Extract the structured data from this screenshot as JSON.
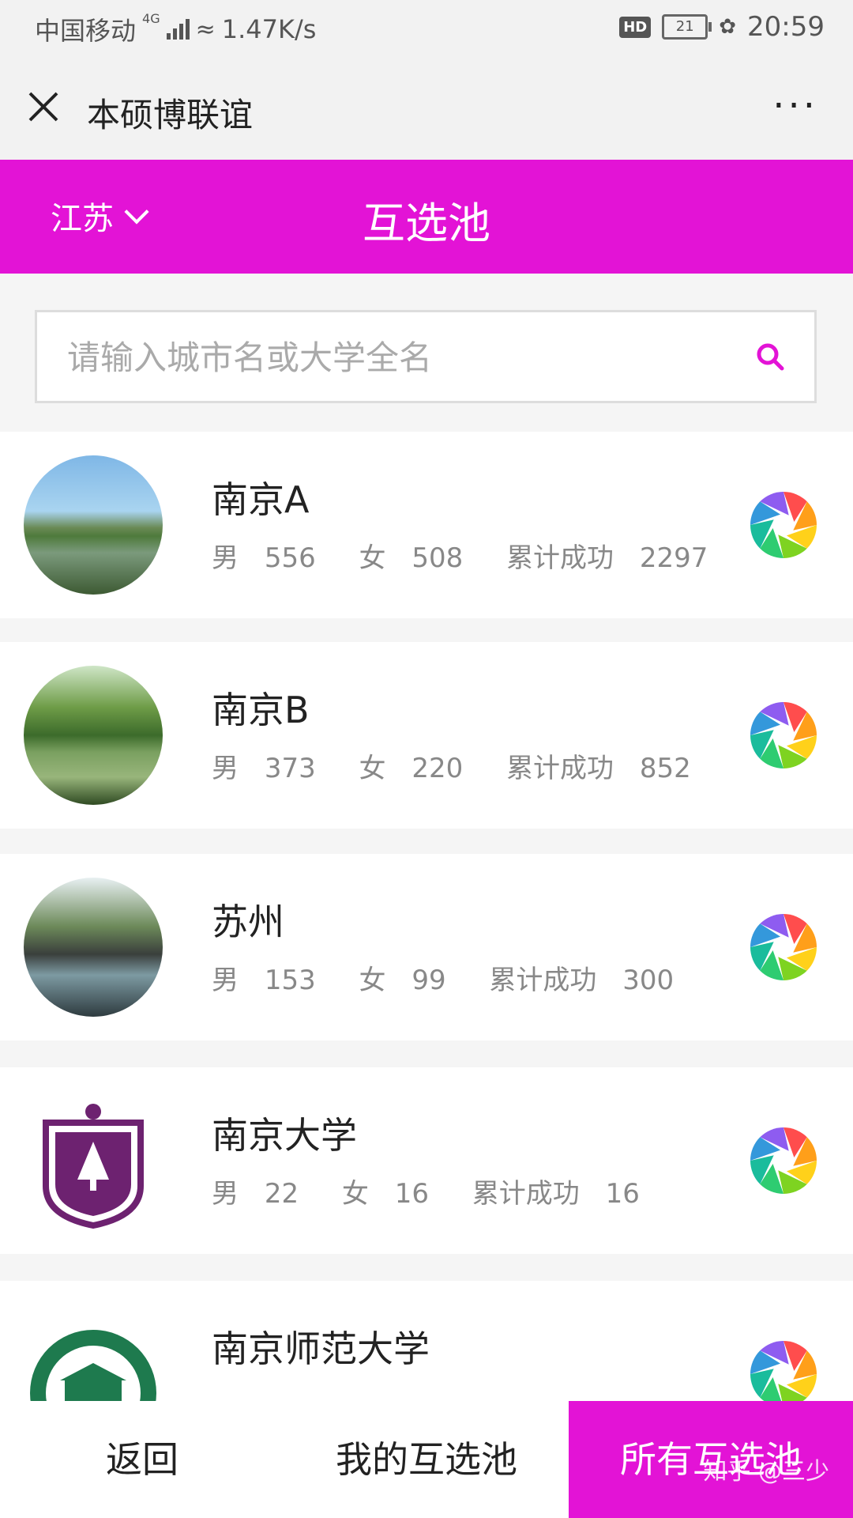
{
  "status_bar": {
    "carrier": "中国移动",
    "network": "4G",
    "speed": "1.47K/s",
    "hd": "HD",
    "battery": "21",
    "time": "20:59"
  },
  "title_bar": {
    "title": "本硕博联谊",
    "more": "···"
  },
  "header": {
    "province": "江苏",
    "title": "互选池",
    "accent_color": "#e313d6"
  },
  "search": {
    "placeholder": "请输入城市名或大学全名"
  },
  "pools": [
    {
      "name": "南京A",
      "male_label": "男",
      "male": "556",
      "female_label": "女",
      "female": "508",
      "success_label": "累计成功",
      "success": "2297"
    },
    {
      "name": "南京B",
      "male_label": "男",
      "male": "373",
      "female_label": "女",
      "female": "220",
      "success_label": "累计成功",
      "success": "852"
    },
    {
      "name": "苏州",
      "male_label": "男",
      "male": "153",
      "female_label": "女",
      "female": "99",
      "success_label": "累计成功",
      "success": "300"
    },
    {
      "name": "南京大学",
      "male_label": "男",
      "male": "22",
      "female_label": "女",
      "female": "16",
      "success_label": "累计成功",
      "success": "16"
    },
    {
      "name": "南京师范大学"
    }
  ],
  "bottom_nav": {
    "back": "返回",
    "mine": "我的互选池",
    "all": "所有互选池"
  },
  "watermark": "知乎 @三少"
}
